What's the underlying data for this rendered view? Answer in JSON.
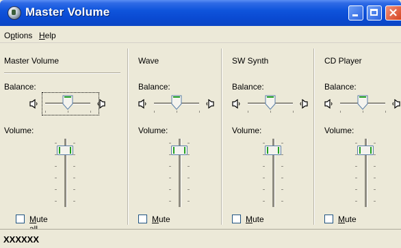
{
  "window": {
    "title": "Master Volume",
    "icon": "volume-control-icon",
    "controls": [
      "minimize-icon",
      "maximize-icon",
      "close-icon"
    ],
    "close_glyph": "×"
  },
  "menu": {
    "options_prefix": "O",
    "options_accel": "p",
    "options_rest": "tions",
    "help_accel": "H",
    "help_rest": "elp"
  },
  "columns": [
    {
      "title": "Master Volume",
      "balance_label": "Balance:",
      "volume_label": "Volume:",
      "mute_accel": "M",
      "mute_rest": "ute all",
      "balance": 0.5,
      "volume": 0.96,
      "muted": false,
      "focused": true
    },
    {
      "title": "Wave",
      "balance_label": "Balance:",
      "volume_label": "Volume:",
      "mute_accel": "M",
      "mute_rest": "ute",
      "balance": 0.5,
      "volume": 0.96,
      "muted": false,
      "focused": false
    },
    {
      "title": "SW Synth",
      "balance_label": "Balance:",
      "volume_label": "Volume:",
      "mute_accel": "M",
      "mute_rest": "ute",
      "balance": 0.5,
      "volume": 0.96,
      "muted": false,
      "focused": false
    },
    {
      "title": "CD Player",
      "balance_label": "Balance:",
      "volume_label": "Volume:",
      "mute_accel": "M",
      "mute_rest": "ute",
      "balance": 0.5,
      "volume": 0.96,
      "muted": false,
      "focused": false
    }
  ],
  "status": {
    "text": "XXXXXX"
  },
  "colors": {
    "titlebar": "#0a4ad2",
    "face": "#ece9d8",
    "thumb_accent": "#21a121",
    "checkbox_border": "#1c5180"
  }
}
